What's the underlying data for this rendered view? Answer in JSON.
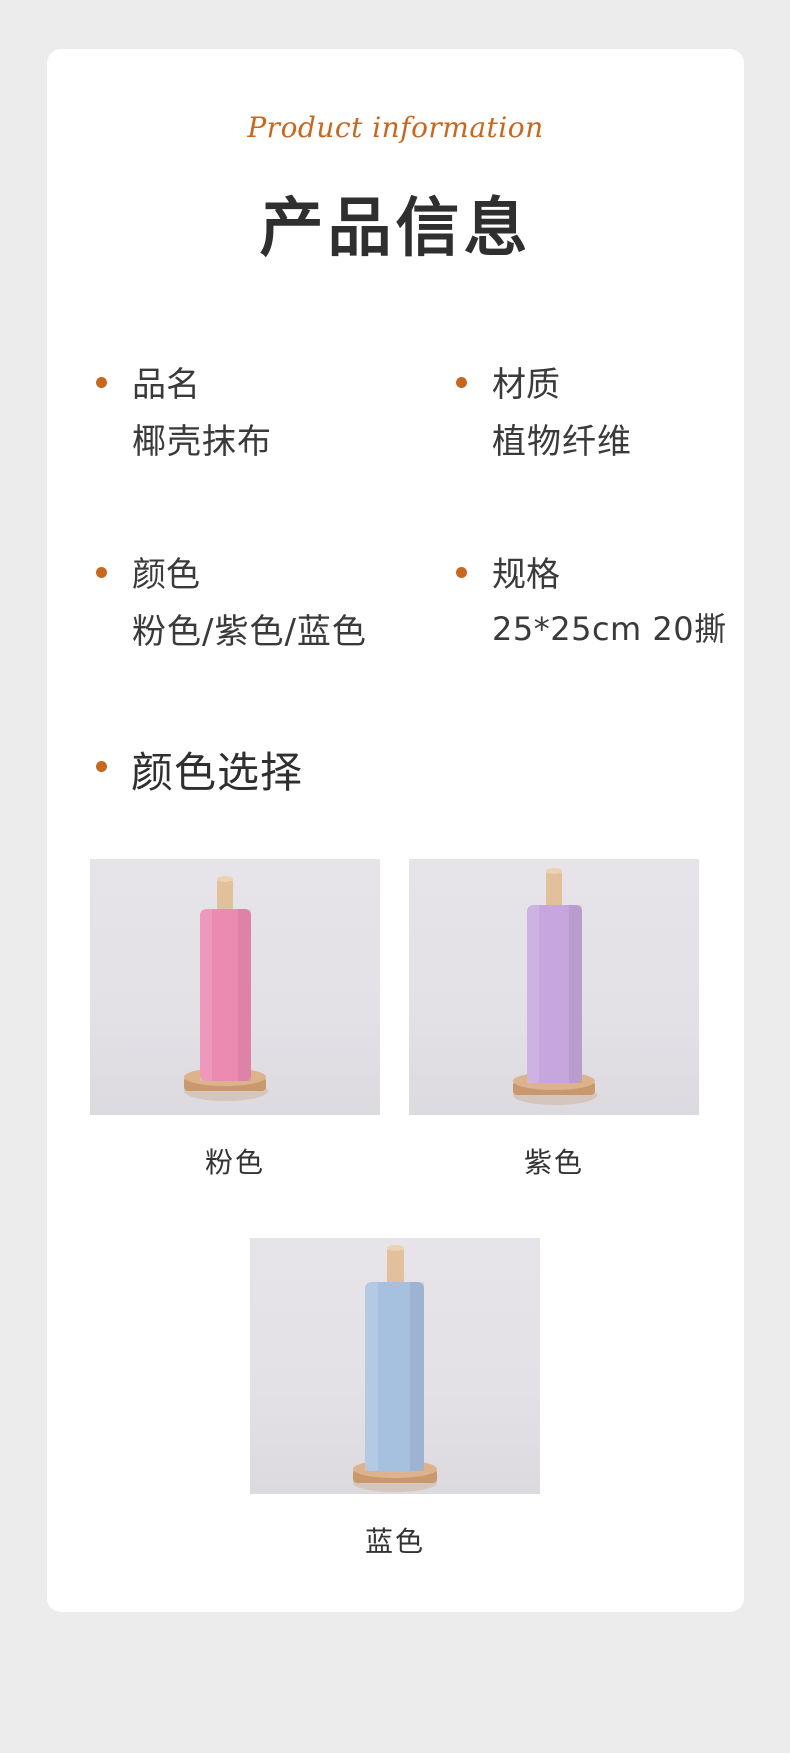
{
  "header": {
    "subtitle": "Product information",
    "title": "产品信息"
  },
  "specs": {
    "name": {
      "label": "品名",
      "value": "椰壳抹布"
    },
    "material": {
      "label": "材质",
      "value": "植物纤维"
    },
    "color": {
      "label": "颜色",
      "value": "粉色/紫色/蓝色"
    },
    "size": {
      "label": "规格",
      "value": "25*25cm 20撕"
    }
  },
  "color_section": {
    "title": "颜色选择",
    "options": [
      {
        "label": "粉色",
        "roll_color": "#ec8bb2"
      },
      {
        "label": "紫色",
        "roll_color": "#c6a6dc"
      },
      {
        "label": "蓝色",
        "roll_color": "#a6c0e0"
      }
    ]
  },
  "colors": {
    "accent": "#c8671f",
    "background": "#ececed",
    "card": "#ffffff",
    "wood": "#dcb38c"
  }
}
